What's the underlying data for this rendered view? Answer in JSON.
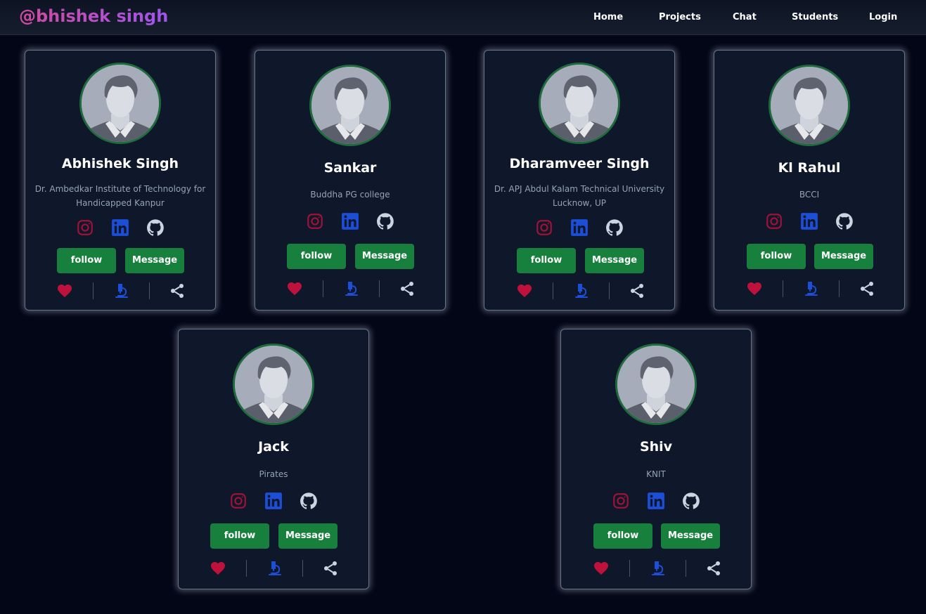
{
  "navbar": {
    "brand": "@bhishek singh",
    "links": [
      "Home",
      "Projects",
      "Chat",
      "Students",
      "Login"
    ]
  },
  "colors": {
    "background": "#030617",
    "card": "#0f172a",
    "button": "#16803c",
    "avatar_ring": "#1e6b3b",
    "heart": "#be123c",
    "instagram": "#9f1239",
    "linkedin": "#1d4ed8",
    "github": "#cbd5e1",
    "microscope": "#1d4ed8",
    "share": "#cbd5e1"
  },
  "icons": [
    "instagram-icon",
    "linkedin-icon",
    "github-icon",
    "heart-icon",
    "microscope-icon",
    "share-icon"
  ],
  "students": [
    {
      "name": "Abhishek Singh",
      "school": "Dr. Ambedkar Institute of Technology for Handicapped Kanpur",
      "follow_label": "follow",
      "message_label": "Message"
    },
    {
      "name": "Sankar",
      "school": "Buddha PG college",
      "follow_label": "follow",
      "message_label": "Message"
    },
    {
      "name": "Dharamveer Singh",
      "school": "Dr. APJ Abdul Kalam Technical University Lucknow, UP",
      "follow_label": "follow",
      "message_label": "Message"
    },
    {
      "name": "Kl Rahul",
      "school": "BCCI",
      "follow_label": "follow",
      "message_label": "Message"
    },
    {
      "name": "Jack",
      "school": "Pirates",
      "follow_label": "follow",
      "message_label": "Message"
    },
    {
      "name": "Shiv",
      "school": "KNIT",
      "follow_label": "follow",
      "message_label": "Message"
    }
  ]
}
